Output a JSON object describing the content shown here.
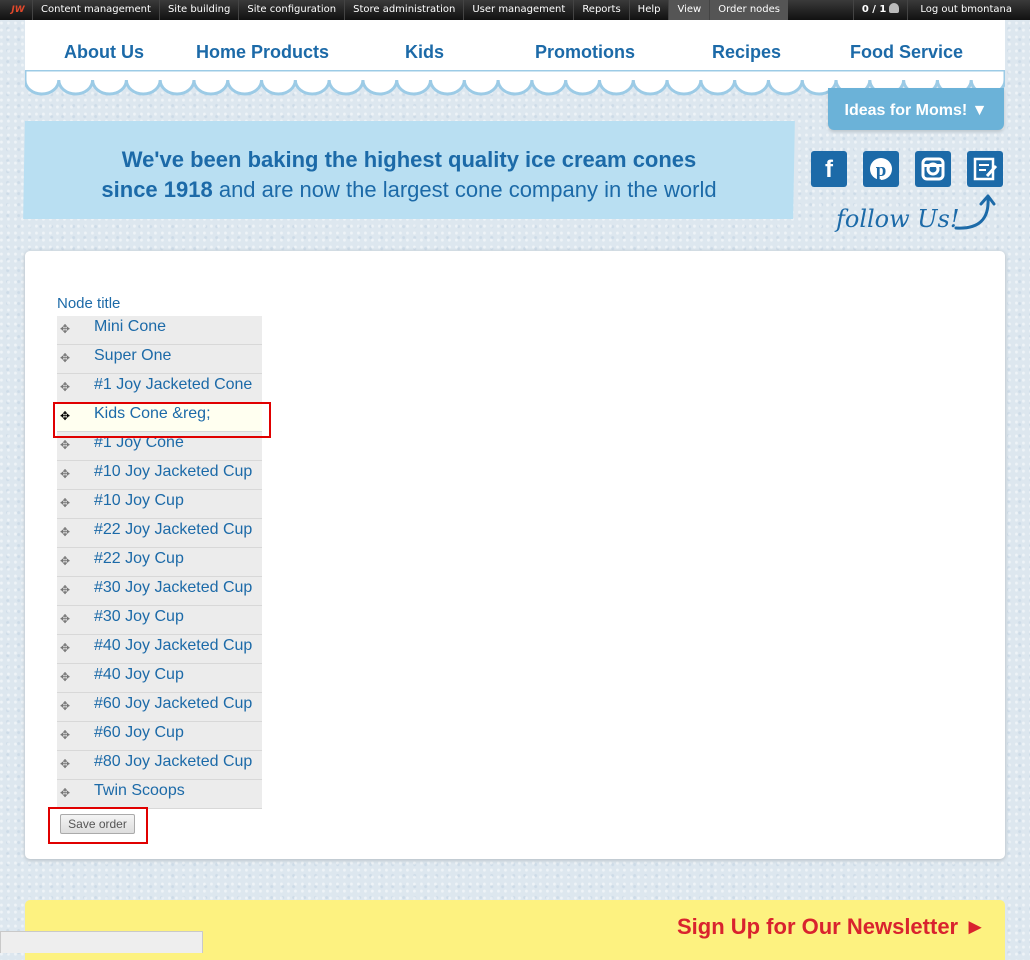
{
  "admin_bar": {
    "logo": "JW",
    "items": [
      "Content management",
      "Site building",
      "Site configuration",
      "Store administration",
      "User management",
      "Reports",
      "Help",
      "View",
      "Order nodes"
    ],
    "user_count": "0 / 1",
    "logout": "Log out bmontana"
  },
  "nav": {
    "items": [
      "About Us",
      "Home Products",
      "Kids",
      "Promotions",
      "Recipes",
      "Food Service"
    ],
    "ideas_tab": "Ideas for Moms! ▼"
  },
  "banner": {
    "line1_bold": "We've been baking the highest quality ice cream cones",
    "line2_bold": "since 1918",
    "line2_rest": " and are now the largest cone company in the world"
  },
  "social": {
    "icons": [
      "facebook-icon",
      "pinterest-icon",
      "instagram-icon",
      "blog-icon"
    ],
    "follow_label": "follow Us!"
  },
  "table": {
    "header": "Node title",
    "rows": [
      "Mini Cone",
      "Super One",
      "#1 Joy Jacketed Cone",
      "Kids Cone &reg;",
      "#1 Joy Cone",
      "#10 Joy Jacketed Cup",
      "#10 Joy Cup",
      "#22 Joy Jacketed Cup",
      "#22 Joy Cup",
      "#30 Joy Jacketed Cup",
      "#30 Joy Cup",
      "#40 Joy Jacketed Cup",
      "#40 Joy Cup",
      "#60 Joy Jacketed Cup",
      "#60 Joy Cup",
      "#80 Joy Jacketed Cup",
      "Twin Scoops"
    ],
    "save_label": "Save order"
  },
  "newsletter": {
    "label": "Sign Up for Our Newsletter ►"
  },
  "colors": {
    "brand_blue": "#1c6aa8",
    "newsletter_red": "#d9232e",
    "highlight_red": "#e00000"
  }
}
